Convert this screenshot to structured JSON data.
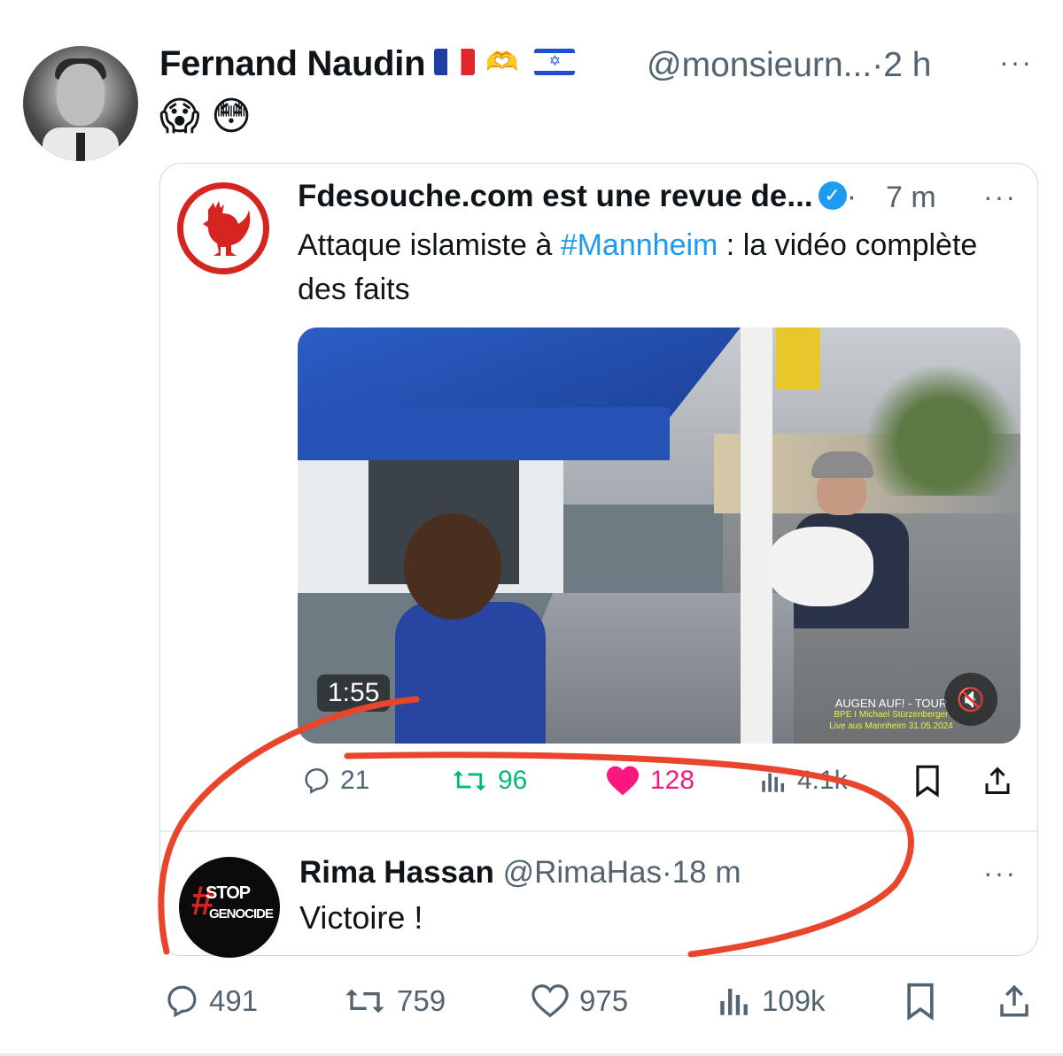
{
  "post": {
    "author_name": "Fernand Naudin",
    "handle": "@monsieurn...",
    "separator": "·",
    "time": "2 h",
    "more": "···",
    "text_emojis": "😱 😳",
    "badges": [
      "flag-france-icon",
      "heart-hands-icon",
      "flag-israel-icon"
    ]
  },
  "quoted": {
    "author_name": "Fdesouche.com est une revue de...",
    "verified": true,
    "separator": "·",
    "time": "7 m",
    "more": "···",
    "text_before": "Attaque islamiste à ",
    "hashtag": "#Mannheim",
    "text_after": " : la vidéo complète des faits",
    "video": {
      "duration": "1:55",
      "watermark_line1": "AUGEN AUF! - TOUR",
      "watermark_line2": "BPE I Michael Stürzenberger",
      "watermark_line3": "Live aus Mannheim 31.05.2024"
    },
    "stats": {
      "replies": "21",
      "reposts": "96",
      "likes": "128",
      "views": "4.1k"
    },
    "colors": {
      "repost": "#00ba7c",
      "like": "#f91880",
      "link": "#1d9bf0"
    }
  },
  "reply": {
    "author_name": "Rima Hassan",
    "handle": "@RimaHas",
    "separator": "·",
    "time": "18 m",
    "more": "···",
    "text": "Victoire !",
    "avatar_text_1": "STOP",
    "avatar_text_2": "GENOCIDE"
  },
  "actions": {
    "replies": "491",
    "reposts": "759",
    "likes": "975",
    "views": "109k"
  },
  "annotation_color": "#e8452c"
}
